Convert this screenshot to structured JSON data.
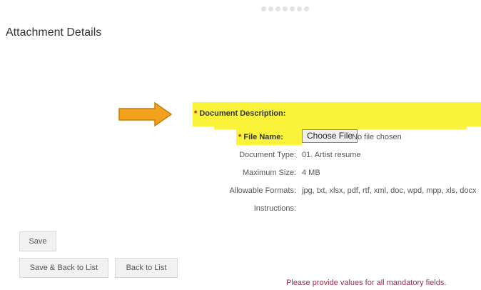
{
  "page": {
    "title": "Attachment Details"
  },
  "form": {
    "description_label": "Document Description:",
    "file_label": "File Name:",
    "required_mark": "*",
    "choose_file_label": "Choose File",
    "no_file_text": "No file chosen",
    "rows": [
      {
        "label": "Document Type:",
        "value": "01. Artist resume"
      },
      {
        "label": "Maximum Size:",
        "value": "4 MB"
      },
      {
        "label": "Allowable Formats:",
        "value": "jpg, txt, xlsx, pdf, rtf, xml, doc, wpd, mpp, xls, docx"
      },
      {
        "label": "Instructions:",
        "value": ""
      }
    ]
  },
  "buttons": {
    "save": "Save",
    "save_back": "Save & Back to List",
    "back": "Back to List"
  },
  "message": "Please provide values for all mandatory fields.",
  "annotation": {
    "highlight_color": "#f9f33a",
    "arrow_color": "#f2a21d"
  },
  "icons": {
    "arrow": "arrow-right-icon"
  }
}
